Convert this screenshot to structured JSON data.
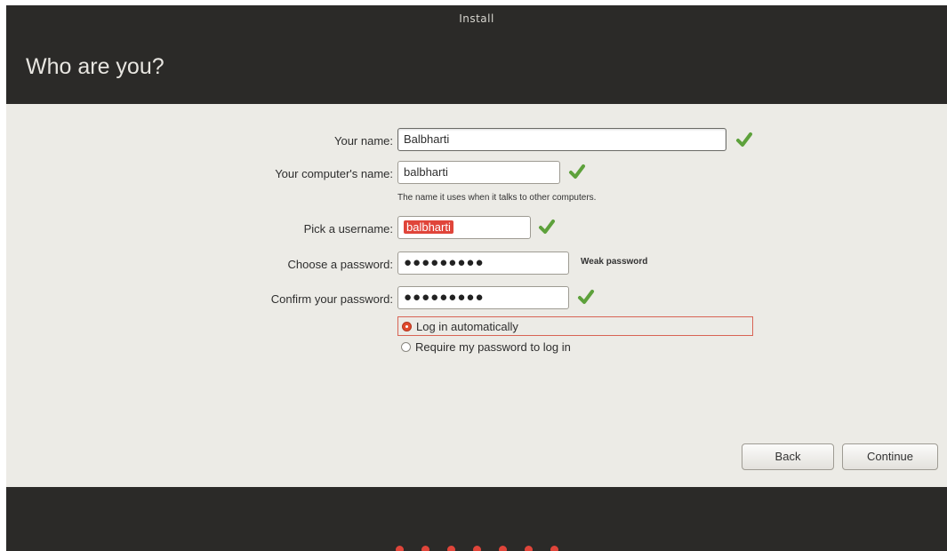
{
  "window": {
    "title": "Install"
  },
  "page": {
    "title": "Who are you?"
  },
  "form": {
    "your_name": {
      "label": "Your name:",
      "value": "Balbharti"
    },
    "computer_name": {
      "label": "Your computer's name:",
      "value": "balbharti",
      "hint": "The name it uses when it talks to other computers."
    },
    "username": {
      "label": "Pick a username:",
      "value": "balbharti"
    },
    "password": {
      "label": "Choose a password:",
      "value": "●●●●●●●●●",
      "strength": "Weak password"
    },
    "confirm_password": {
      "label": "Confirm your password:",
      "value": "●●●●●●●●●"
    },
    "login_options": [
      {
        "label": "Log in automatically",
        "selected": true
      },
      {
        "label": "Require my password to log in",
        "selected": false
      }
    ]
  },
  "buttons": {
    "back": "Back",
    "continue": "Continue"
  },
  "progress": {
    "steps": 7
  },
  "colors": {
    "accent": "#e0453a",
    "check": "#5da13b",
    "header_bg": "#2b2a28",
    "content_bg": "#ecebe6"
  }
}
